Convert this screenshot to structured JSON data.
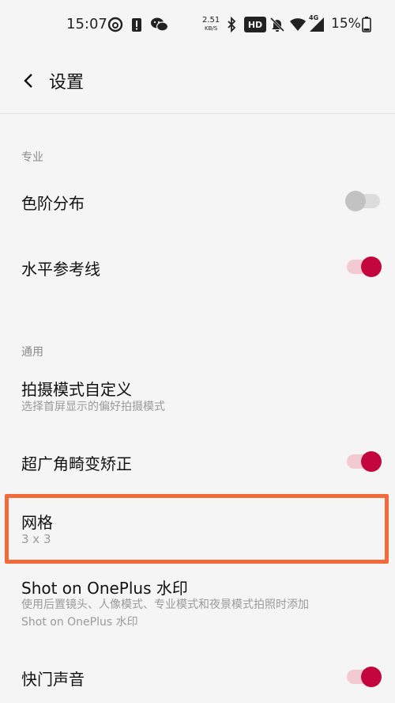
{
  "status_bar": {
    "time": "15:07",
    "net_speed_value": "2.51",
    "net_speed_unit": "KB/S",
    "hd_label": "HD",
    "network_label": "4G",
    "battery_percent": "15%"
  },
  "header": {
    "title": "设置"
  },
  "sections": [
    {
      "label": "专业"
    },
    {
      "label": "通用"
    }
  ],
  "rows": {
    "color_levels": {
      "title": "色阶分布",
      "toggle": "off"
    },
    "level_guide": {
      "title": "水平参考线",
      "toggle": "on"
    },
    "custom_modes": {
      "title": "拍摄模式自定义",
      "subtitle": "选择首屏显示的偏好拍摄模式"
    },
    "ultrawide_correction": {
      "title": "超广角畸变矫正",
      "toggle": "on"
    },
    "grid": {
      "title": "网格",
      "value": "3 x 3"
    },
    "watermark": {
      "title": "Shot on OnePlus 水印",
      "subtitle_line1": "使用后置镜头、人像模式、专业模式和夜景模式拍照时添加",
      "subtitle_line2": "Shot on OnePlus 水印"
    },
    "shutter_sound": {
      "title": "快门声音",
      "toggle": "on"
    }
  },
  "colors": {
    "accent": "#c3063c",
    "accent_track": "#f3c9d2",
    "highlight_border": "#f26a3a"
  }
}
